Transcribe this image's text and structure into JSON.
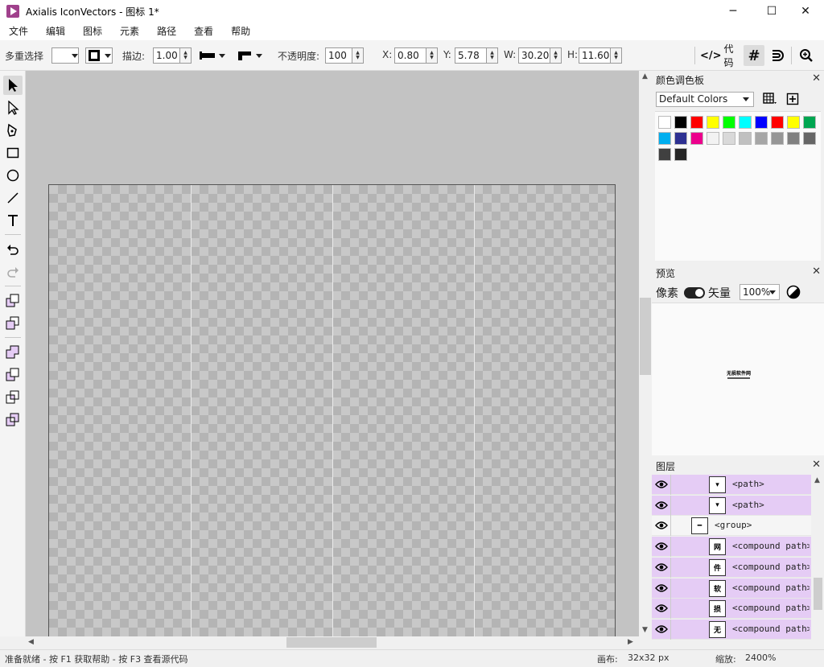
{
  "window": {
    "title": "Axialis IconVectors - 图标 1*",
    "minimize": "─",
    "maximize": "☐",
    "close": "✕"
  },
  "menu": [
    "文件",
    "编辑",
    "图标",
    "元素",
    "路径",
    "查看",
    "帮助"
  ],
  "toolbar": {
    "selection_label": "多重选择",
    "stroke_label": "描边:",
    "stroke_value": "1.00",
    "opacity_label": "不透明度:",
    "opacity_value": "100",
    "x_label": "X:",
    "x_value": "0.80",
    "y_label": "Y:",
    "y_value": "5.78",
    "w_label": "W:",
    "w_value": "30.20",
    "h_label": "H:",
    "h_value": "11.60",
    "code_label": "代码",
    "code_icon": "</>",
    "grid_icon": "#",
    "magnet_icon": "magnet",
    "zoom_icon": "zoom-in"
  },
  "palette": {
    "title": "颜色调色板",
    "close": "✕",
    "selected": "Default Colors",
    "colors": [
      "#ffffff",
      "#000000",
      "#ff0000",
      "#ffff00",
      "#00ff00",
      "#00ffff",
      "#0000ff",
      "#ff0000",
      "#ffff00",
      "#00a651",
      "#00aeef",
      "#2e3192",
      "#ec008c",
      "#f2f2f2",
      "#d9d9d9",
      "#c0c0c0",
      "#a6a6a6",
      "#969696",
      "#808080",
      "#666666",
      "#404040",
      "#262626"
    ]
  },
  "preview": {
    "title": "预览",
    "close": "✕",
    "pixel_label": "像素",
    "vector_label": "矢量",
    "zoom": "100%",
    "thumb_text": "无损软件网"
  },
  "layers": {
    "title": "图层",
    "close": "✕",
    "rows": [
      {
        "name": "<path>",
        "glyph": "▾",
        "sel": true,
        "indent": 1
      },
      {
        "name": "<path>",
        "glyph": "▾",
        "sel": true,
        "indent": 1
      },
      {
        "name": "<group>",
        "glyph": "━",
        "sel": false,
        "indent": 0
      },
      {
        "name": "<compound path>",
        "glyph": "网",
        "sel": true,
        "indent": 1
      },
      {
        "name": "<compound path>",
        "glyph": "件",
        "sel": true,
        "indent": 1
      },
      {
        "name": "<compound path>",
        "glyph": "软",
        "sel": true,
        "indent": 1
      },
      {
        "name": "<compound path>",
        "glyph": "损",
        "sel": true,
        "indent": 1
      },
      {
        "name": "<compound path>",
        "glyph": "无",
        "sel": true,
        "indent": 1
      }
    ]
  },
  "status": {
    "hint": "准备就绪 - 按 F1 获取帮助 - 按 F3 查看源代码",
    "canvas_label": "画布:",
    "canvas_size": "32x32 px",
    "zoom_label": "缩放:",
    "zoom_value": "2400%"
  }
}
